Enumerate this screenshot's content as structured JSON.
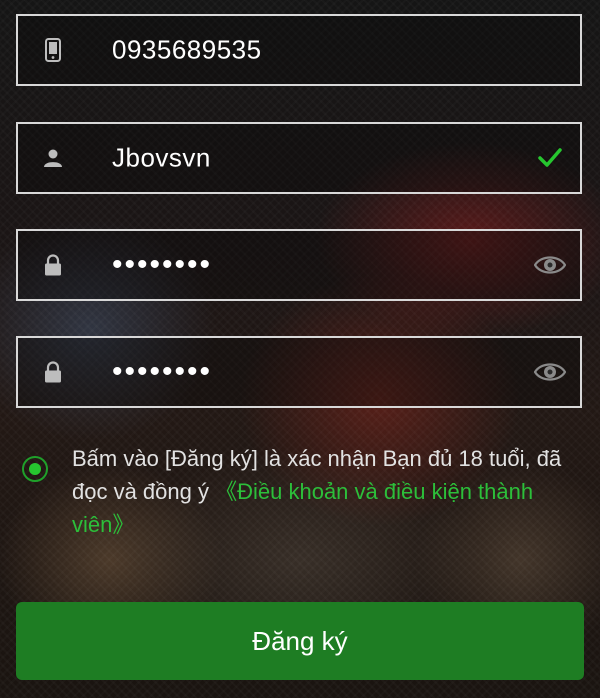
{
  "form": {
    "phone": {
      "value": "0935689535",
      "icon": "phone-icon"
    },
    "username": {
      "value": "Jbovsvn",
      "icon": "user-icon",
      "status": "valid",
      "status_icon": "check-icon"
    },
    "password": {
      "value": "••••••••",
      "icon": "lock-icon",
      "toggle_icon": "eye-icon"
    },
    "confirm_password": {
      "value": "••••••••",
      "icon": "lock-icon",
      "toggle_icon": "eye-icon"
    }
  },
  "agreement": {
    "checked": true,
    "text": "Bấm vào [Đăng ký] là xác nhận Bạn đủ 18 tuổi, đã đọc và đồng ý ",
    "link_text": "《Điều khoản và điều kiện thành viên》"
  },
  "submit": {
    "label": "Đăng ký"
  },
  "colors": {
    "accent_green": "#26c62f",
    "button_green": "#1e7d23",
    "field_border": "#d8d8d8",
    "text": "#ffffff"
  }
}
